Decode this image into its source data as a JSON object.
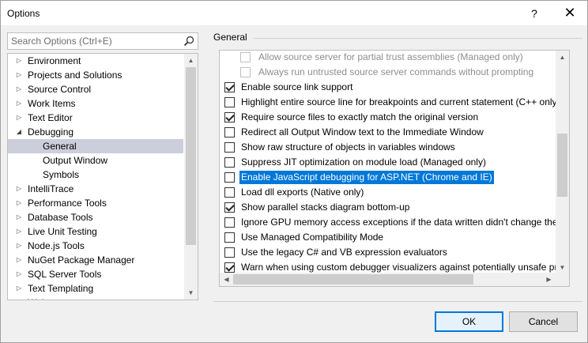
{
  "window": {
    "title": "Options",
    "help_label": "?",
    "close_label": "✕"
  },
  "search": {
    "placeholder": "Search Options (Ctrl+E)",
    "value": ""
  },
  "tree": {
    "items": [
      {
        "label": "Environment",
        "level": 0,
        "state": "collapsed",
        "selected": false
      },
      {
        "label": "Projects and Solutions",
        "level": 0,
        "state": "collapsed",
        "selected": false
      },
      {
        "label": "Source Control",
        "level": 0,
        "state": "collapsed",
        "selected": false
      },
      {
        "label": "Work Items",
        "level": 0,
        "state": "collapsed",
        "selected": false
      },
      {
        "label": "Text Editor",
        "level": 0,
        "state": "collapsed",
        "selected": false
      },
      {
        "label": "Debugging",
        "level": 0,
        "state": "expanded",
        "selected": false
      },
      {
        "label": "General",
        "level": 1,
        "state": "leaf",
        "selected": true
      },
      {
        "label": "Output Window",
        "level": 1,
        "state": "leaf",
        "selected": false
      },
      {
        "label": "Symbols",
        "level": 1,
        "state": "leaf",
        "selected": false
      },
      {
        "label": "IntelliTrace",
        "level": 0,
        "state": "collapsed",
        "selected": false
      },
      {
        "label": "Performance Tools",
        "level": 0,
        "state": "collapsed",
        "selected": false
      },
      {
        "label": "Database Tools",
        "level": 0,
        "state": "collapsed",
        "selected": false
      },
      {
        "label": "Live Unit Testing",
        "level": 0,
        "state": "collapsed",
        "selected": false
      },
      {
        "label": "Node.js Tools",
        "level": 0,
        "state": "collapsed",
        "selected": false
      },
      {
        "label": "NuGet Package Manager",
        "level": 0,
        "state": "collapsed",
        "selected": false
      },
      {
        "label": "SQL Server Tools",
        "level": 0,
        "state": "collapsed",
        "selected": false
      },
      {
        "label": "Text Templating",
        "level": 0,
        "state": "collapsed",
        "selected": false
      },
      {
        "label": "Web",
        "level": 0,
        "state": "collapsed",
        "selected": false
      }
    ]
  },
  "section": {
    "title": "General"
  },
  "options": [
    {
      "label": "Allow source server for partial trust assemblies (Managed only)",
      "checked": false,
      "disabled": true,
      "indent": true,
      "highlight": false
    },
    {
      "label": "Always run untrusted source server commands without prompting",
      "checked": false,
      "disabled": true,
      "indent": true,
      "highlight": false
    },
    {
      "label": "Enable source link support",
      "checked": true,
      "disabled": false,
      "indent": false,
      "highlight": false
    },
    {
      "label": "Highlight entire source line for breakpoints and current statement (C++ only)",
      "checked": false,
      "disabled": false,
      "indent": false,
      "highlight": false
    },
    {
      "label": "Require source files to exactly match the original version",
      "checked": true,
      "disabled": false,
      "indent": false,
      "highlight": false
    },
    {
      "label": "Redirect all Output Window text to the Immediate Window",
      "checked": false,
      "disabled": false,
      "indent": false,
      "highlight": false
    },
    {
      "label": "Show raw structure of objects in variables windows",
      "checked": false,
      "disabled": false,
      "indent": false,
      "highlight": false
    },
    {
      "label": "Suppress JIT optimization on module load (Managed only)",
      "checked": false,
      "disabled": false,
      "indent": false,
      "highlight": false
    },
    {
      "label": "Enable JavaScript debugging for ASP.NET (Chrome and IE)",
      "checked": false,
      "disabled": false,
      "indent": false,
      "highlight": true
    },
    {
      "label": "Load dll exports (Native only)",
      "checked": false,
      "disabled": false,
      "indent": false,
      "highlight": false
    },
    {
      "label": "Show parallel stacks diagram bottom-up",
      "checked": true,
      "disabled": false,
      "indent": false,
      "highlight": false
    },
    {
      "label": "Ignore GPU memory access exceptions if the data written didn't change the value",
      "checked": false,
      "disabled": false,
      "indent": false,
      "highlight": false
    },
    {
      "label": "Use Managed Compatibility Mode",
      "checked": false,
      "disabled": false,
      "indent": false,
      "highlight": false
    },
    {
      "label": "Use the legacy C# and VB expression evaluators",
      "checked": false,
      "disabled": false,
      "indent": false,
      "highlight": false
    },
    {
      "label": "Warn when using custom debugger visualizers against potentially unsafe processes",
      "checked": true,
      "disabled": false,
      "indent": false,
      "highlight": false
    }
  ],
  "buttons": {
    "ok": "OK",
    "cancel": "Cancel"
  },
  "colors": {
    "selection_blue": "#0078d7",
    "tree_selected": "#cccedb",
    "window_bg": "#f0f0f0"
  }
}
